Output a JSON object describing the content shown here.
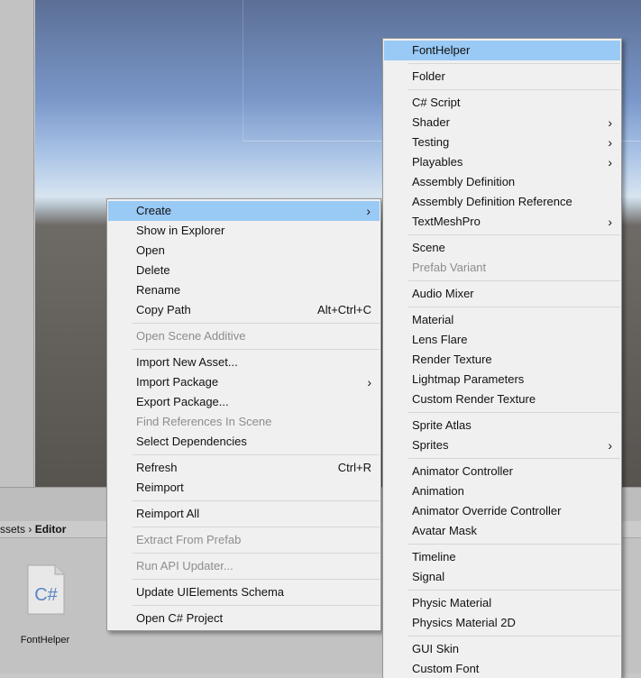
{
  "project": {
    "breadcrumb_prefix": "ssets",
    "breadcrumb_sep": "›",
    "breadcrumb_current": "Editor",
    "file_name": "FontHelper",
    "file_icon_text": "C#"
  },
  "context_menu": {
    "items": [
      {
        "label": "Create",
        "submenu": true,
        "selected": true
      },
      {
        "label": "Show in Explorer"
      },
      {
        "label": "Open"
      },
      {
        "label": "Delete"
      },
      {
        "label": "Rename"
      },
      {
        "label": "Copy Path",
        "shortcut": "Alt+Ctrl+C"
      },
      {
        "separator": true
      },
      {
        "label": "Open Scene Additive",
        "disabled": true
      },
      {
        "separator": true
      },
      {
        "label": "Import New Asset..."
      },
      {
        "label": "Import Package",
        "submenu": true
      },
      {
        "label": "Export Package..."
      },
      {
        "label": "Find References In Scene",
        "disabled": true
      },
      {
        "label": "Select Dependencies"
      },
      {
        "separator": true
      },
      {
        "label": "Refresh",
        "shortcut": "Ctrl+R"
      },
      {
        "label": "Reimport"
      },
      {
        "separator": true
      },
      {
        "label": "Reimport All"
      },
      {
        "separator": true
      },
      {
        "label": "Extract From Prefab",
        "disabled": true
      },
      {
        "separator": true
      },
      {
        "label": "Run API Updater...",
        "disabled": true
      },
      {
        "separator": true
      },
      {
        "label": "Update UIElements Schema"
      },
      {
        "separator": true
      },
      {
        "label": "Open C# Project"
      }
    ]
  },
  "create_menu": {
    "items": [
      {
        "label": "FontHelper",
        "selected": true
      },
      {
        "separator": true
      },
      {
        "label": "Folder"
      },
      {
        "separator": true
      },
      {
        "label": "C# Script"
      },
      {
        "label": "Shader",
        "submenu": true
      },
      {
        "label": "Testing",
        "submenu": true
      },
      {
        "label": "Playables",
        "submenu": true
      },
      {
        "label": "Assembly Definition"
      },
      {
        "label": "Assembly Definition Reference"
      },
      {
        "label": "TextMeshPro",
        "submenu": true
      },
      {
        "separator": true
      },
      {
        "label": "Scene"
      },
      {
        "label": "Prefab Variant",
        "disabled": true
      },
      {
        "separator": true
      },
      {
        "label": "Audio Mixer"
      },
      {
        "separator": true
      },
      {
        "label": "Material"
      },
      {
        "label": "Lens Flare"
      },
      {
        "label": "Render Texture"
      },
      {
        "label": "Lightmap Parameters"
      },
      {
        "label": "Custom Render Texture"
      },
      {
        "separator": true
      },
      {
        "label": "Sprite Atlas"
      },
      {
        "label": "Sprites",
        "submenu": true
      },
      {
        "separator": true
      },
      {
        "label": "Animator Controller"
      },
      {
        "label": "Animation"
      },
      {
        "label": "Animator Override Controller"
      },
      {
        "label": "Avatar Mask"
      },
      {
        "separator": true
      },
      {
        "label": "Timeline"
      },
      {
        "label": "Signal"
      },
      {
        "separator": true
      },
      {
        "label": "Physic Material"
      },
      {
        "label": "Physics Material 2D"
      },
      {
        "separator": true
      },
      {
        "label": "GUI Skin"
      },
      {
        "label": "Custom Font"
      }
    ]
  },
  "icons": {
    "submenu_arrow": "›"
  },
  "colors": {
    "selection": "#99c9f5",
    "menu_bg": "#f0f0f0",
    "disabled_text": "#8d8d8d"
  }
}
